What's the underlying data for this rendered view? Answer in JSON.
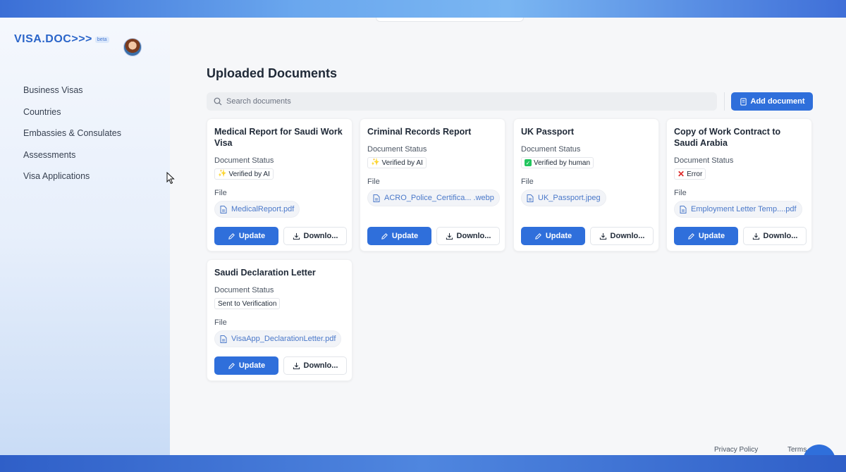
{
  "app": {
    "logo": "VISA.DOC>>>",
    "beta": "beta"
  },
  "sidebar": {
    "items": [
      {
        "label": "Business Visas"
      },
      {
        "label": "Countries"
      },
      {
        "label": "Embassies & Consulates"
      },
      {
        "label": "Assessments"
      },
      {
        "label": "Visa Applications"
      }
    ]
  },
  "main": {
    "title": "Uploaded Documents",
    "search_placeholder": "Search documents",
    "add_button": "Add document",
    "status_label": "Document Status",
    "file_label": "File",
    "update_label": "Update",
    "download_label": "Downlo...",
    "documents": [
      {
        "title": "Medical Report for Saudi Work Visa",
        "status": "Verified by AI",
        "status_icon": "sparkle-icon",
        "file": "MedicalReport.pdf"
      },
      {
        "title": "Criminal Records Report",
        "status": "Verified by AI",
        "status_icon": "sparkle-icon",
        "file": "ACRO_Police_Certifica... .webp"
      },
      {
        "title": "UK Passport",
        "status": "Verified by human",
        "status_icon": "check-icon",
        "file": "UK_Passport.jpeg"
      },
      {
        "title": "Copy of Work Contract to Saudi Arabia",
        "status": "Error",
        "status_icon": "error-icon",
        "file": "Employment Letter Temp....pdf"
      },
      {
        "title": "Saudi Declaration Letter",
        "status": "Sent to Verification",
        "status_icon": "",
        "file": "VisaApp_DeclarationLetter.pdf"
      }
    ]
  },
  "footer": {
    "privacy": "Privacy Policy",
    "terms": "Terms"
  },
  "colors": {
    "accent": "#2f6fdb",
    "error": "#dc2626",
    "success": "#22c55e"
  }
}
